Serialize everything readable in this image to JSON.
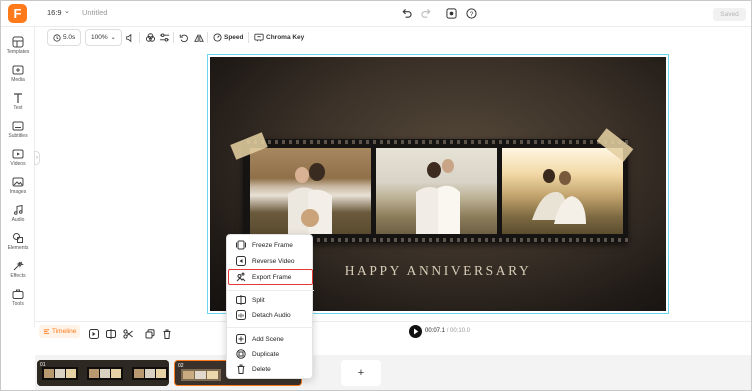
{
  "app": {
    "logo_letter": "F",
    "aspect_ratio": "16:9",
    "project_title": "Untitled",
    "saved_label": "Saved",
    "accent_color": "#ff7a1a"
  },
  "sidebar": {
    "items": [
      {
        "label": "Templates",
        "icon": "templates-icon"
      },
      {
        "label": "Media",
        "icon": "media-icon"
      },
      {
        "label": "Text",
        "icon": "text-icon"
      },
      {
        "label": "Subtitles",
        "icon": "subtitles-icon"
      },
      {
        "label": "Videos",
        "icon": "videos-icon"
      },
      {
        "label": "Images",
        "icon": "images-icon"
      },
      {
        "label": "Audio",
        "icon": "audio-icon"
      },
      {
        "label": "Elements",
        "icon": "elements-icon"
      },
      {
        "label": "Effects",
        "icon": "effects-icon"
      },
      {
        "label": "Tools",
        "icon": "tools-icon"
      }
    ]
  },
  "toolbar": {
    "duration": "5.0s",
    "zoom": "100%",
    "speed_label": "Speed",
    "chroma_label": "Chroma Key"
  },
  "canvas": {
    "caption": "HAPPY ANNIVERSARY"
  },
  "timeline": {
    "tab_label": "Timeline",
    "current_time": "00:07.1",
    "total_time": "/ 00:10.0",
    "clips": [
      {
        "number": "01"
      },
      {
        "number": "02"
      }
    ],
    "add_label": "+"
  },
  "context_menu": {
    "items": [
      {
        "label": "Freeze Frame",
        "icon": "freeze-frame-icon"
      },
      {
        "label": "Reverse Video",
        "icon": "reverse-video-icon"
      },
      {
        "label": "Export Frame",
        "icon": "export-frame-icon",
        "highlighted": true
      },
      {
        "label": "Split",
        "icon": "split-icon"
      },
      {
        "label": "Detach Audio",
        "icon": "detach-audio-icon"
      },
      {
        "label": "Add Scene",
        "icon": "add-scene-icon"
      },
      {
        "label": "Duplicate",
        "icon": "duplicate-icon"
      },
      {
        "label": "Delete",
        "icon": "trash-icon"
      }
    ]
  }
}
